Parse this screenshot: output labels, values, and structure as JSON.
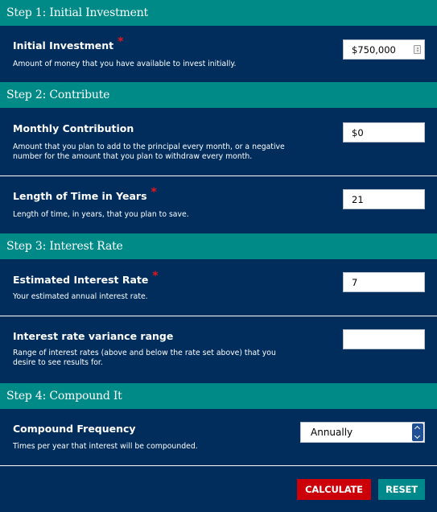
{
  "steps": [
    {
      "title": "Step 1: Initial Investment",
      "fields": [
        {
          "label": "Initial Investment",
          "required": true,
          "required_mark": "*",
          "help": "Amount of money that you have available to invest initially.",
          "value": "$750,000",
          "icon": "stepper-icon"
        }
      ]
    },
    {
      "title": "Step 2: Contribute",
      "fields": [
        {
          "label": "Monthly Contribution",
          "required": false,
          "help": "Amount that you plan to add to the principal every month, or a negative number for the amount that you plan to withdraw every month.",
          "value": "$0"
        },
        {
          "label": "Length of Time in Years",
          "required": true,
          "required_mark": "*",
          "help": "Length of time, in years, that you plan to save.",
          "value": "21"
        }
      ]
    },
    {
      "title": "Step 3: Interest Rate",
      "fields": [
        {
          "label": "Estimated Interest Rate",
          "required": true,
          "required_mark": "*",
          "help": "Your estimated annual interest rate.",
          "value": "7"
        },
        {
          "label": "Interest rate variance range",
          "required": false,
          "help": "Range of interest rates (above and below the rate set above) that you desire to see results for.",
          "value": ""
        }
      ]
    },
    {
      "title": "Step 4: Compound It",
      "fields": [
        {
          "label": "Compound Frequency",
          "required": false,
          "help": "Times per year that interest will be compounded.",
          "selected": "Annually",
          "icon": "select-arrows-icon"
        }
      ]
    }
  ],
  "buttons": {
    "calculate": "CALCULATE",
    "reset": "RESET"
  },
  "colors": {
    "background": "#002d5c",
    "step_header": "#008a87",
    "required_asterisk": "#e8161b",
    "calculate_button": "#cc0008",
    "reset_button": "#00898a"
  }
}
